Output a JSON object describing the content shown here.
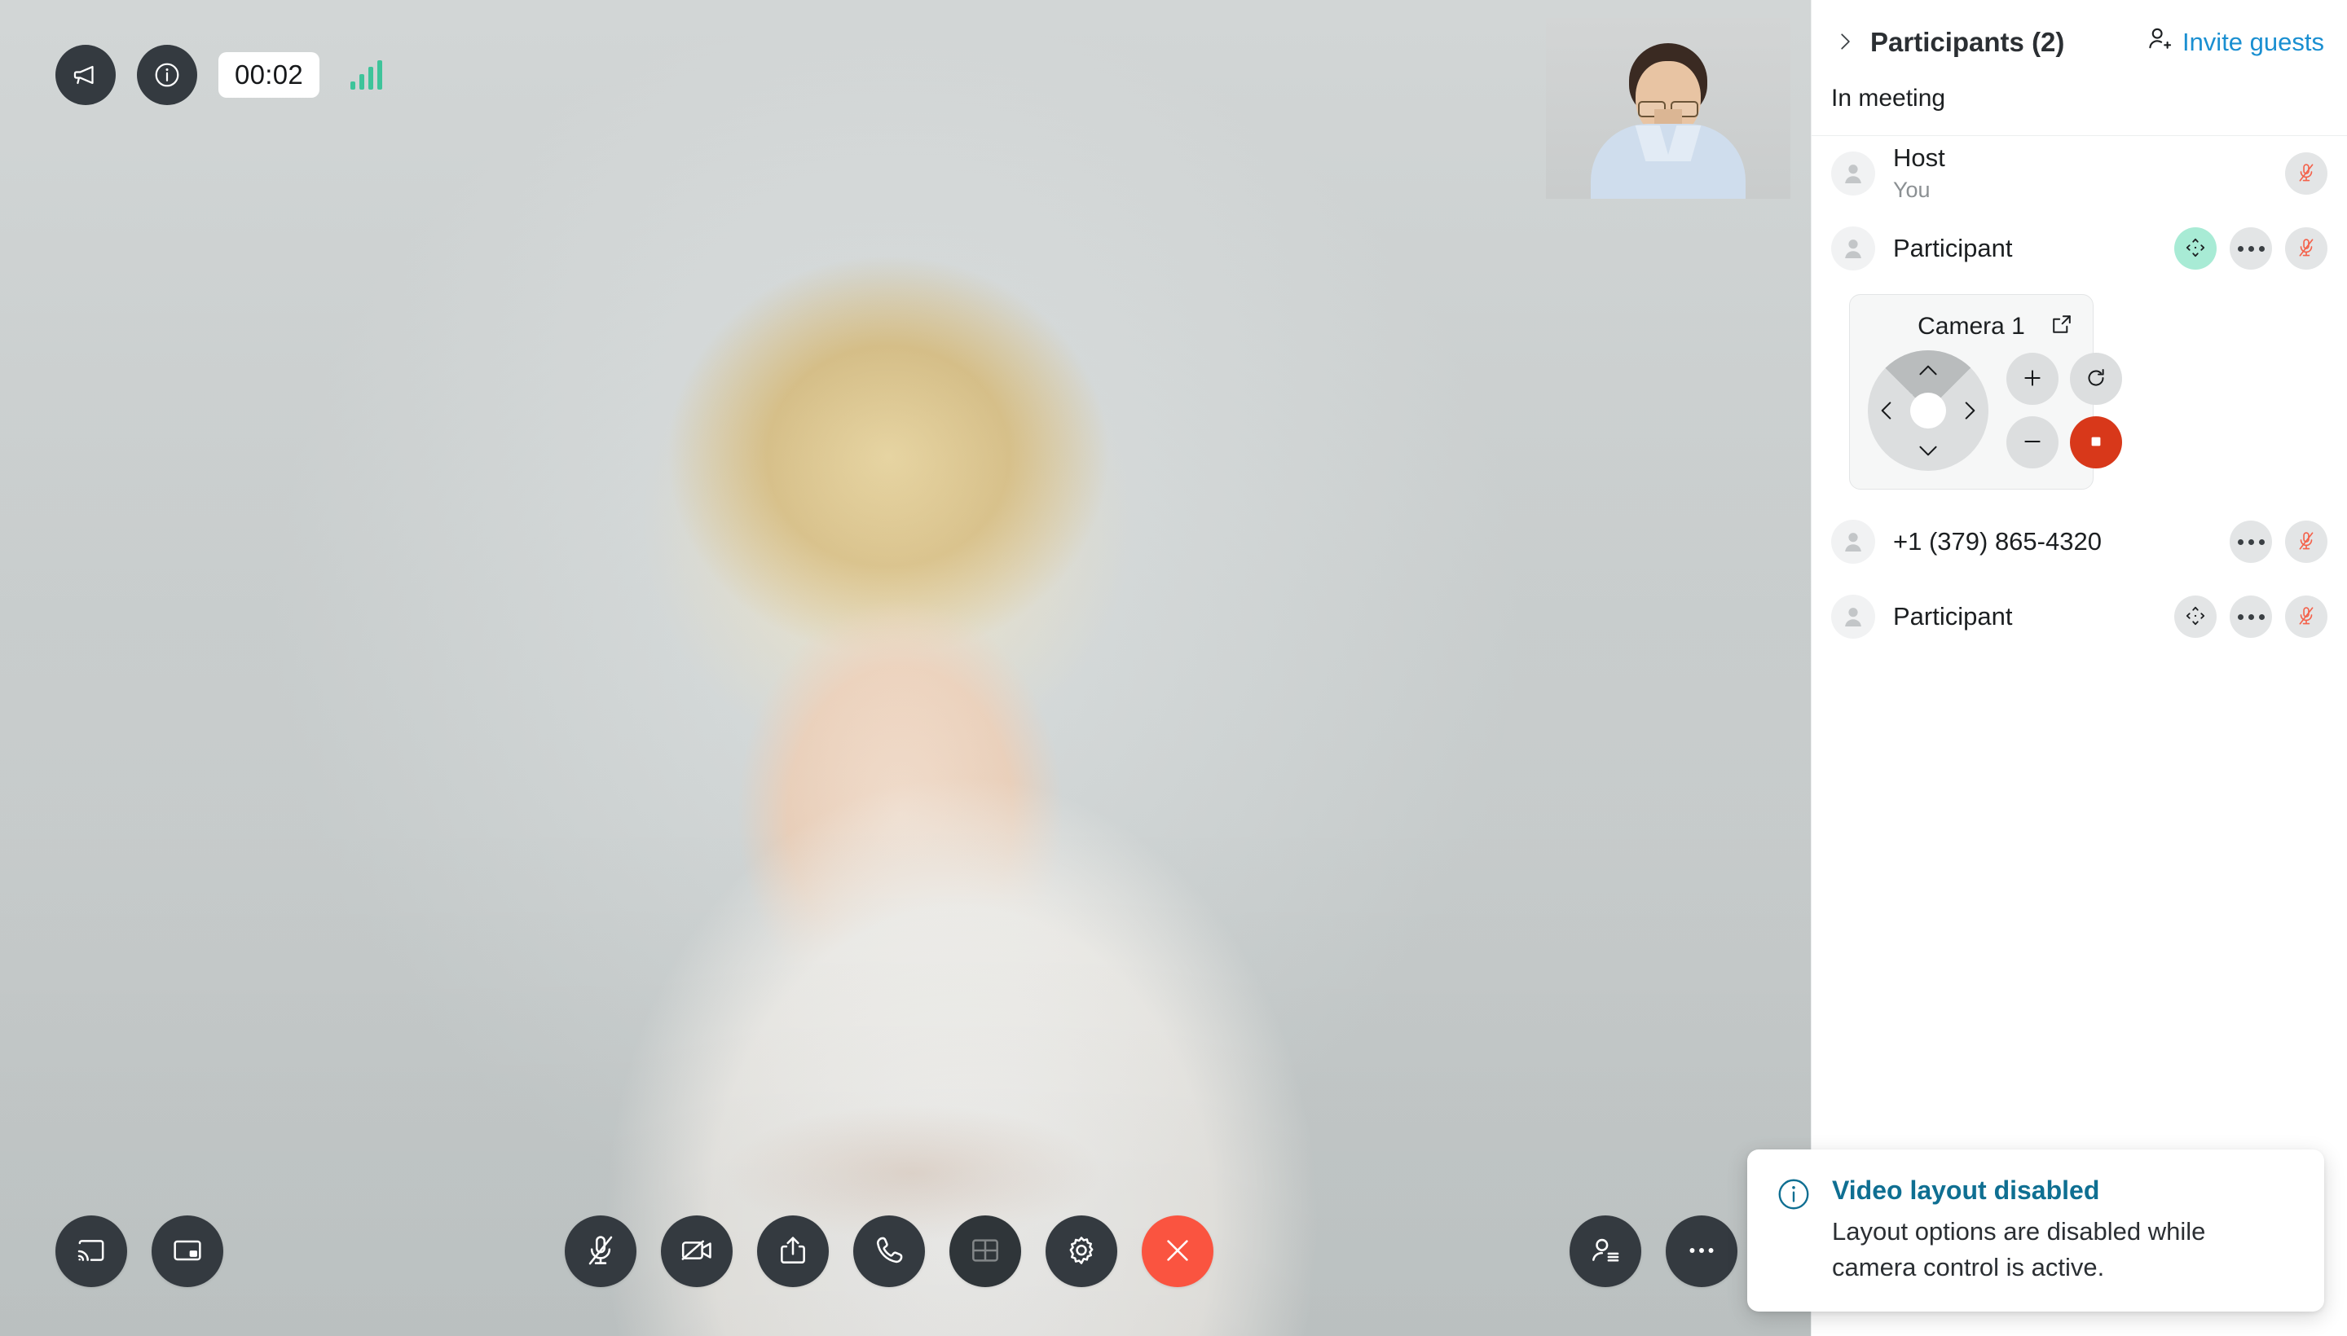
{
  "stage": {
    "timer": "00:02",
    "signal_bars": 4,
    "signal_color": "#3ec49a",
    "banner_icon": "megaphone-icon",
    "info_icon": "info-icon",
    "selfview_label": "self-view"
  },
  "toolbar": {
    "left": [
      {
        "name": "cast-button",
        "icon": "cast-icon"
      },
      {
        "name": "picture-in-picture-button",
        "icon": "picture-in-picture-icon"
      }
    ],
    "center": [
      {
        "name": "microphone-button",
        "icon": "microphone-muted-icon",
        "state": "muted"
      },
      {
        "name": "camera-button",
        "icon": "camera-off-icon",
        "state": "off"
      },
      {
        "name": "share-button",
        "icon": "share-icon",
        "state": "default"
      },
      {
        "name": "dialpad-button",
        "icon": "phone-icon",
        "state": "default"
      },
      {
        "name": "layout-button",
        "icon": "layout-grid-icon",
        "state": "disabled"
      },
      {
        "name": "settings-button",
        "icon": "gear-icon",
        "state": "default"
      },
      {
        "name": "end-call-button",
        "icon": "close-icon",
        "state": "danger",
        "color": "#fa5440"
      }
    ],
    "right": [
      {
        "name": "participants-button",
        "icon": "participants-icon"
      },
      {
        "name": "more-options-button",
        "icon": "more-icon"
      }
    ]
  },
  "sidebar": {
    "title": "Participants (2)",
    "collapse_icon": "chevron-right-icon",
    "invite_label": "Invite guests",
    "invite_icon": "add-person-icon",
    "invite_color": "#1a8fd1",
    "section_label": "In meeting",
    "participants": [
      {
        "name": "Host",
        "sub": "You",
        "avatar_icon": "person-icon",
        "has_camera_control": false,
        "has_more": false,
        "mic": "muted"
      },
      {
        "name": "Participant",
        "sub": "",
        "avatar_icon": "person-icon",
        "has_camera_control": true,
        "camera_control_active": true,
        "has_more": true,
        "mic": "muted"
      },
      {
        "name": "+1 (379) 865-4320",
        "sub": "",
        "avatar_icon": "person-icon",
        "has_camera_control": false,
        "has_more": true,
        "mic": "muted"
      },
      {
        "name": "Participant",
        "sub": "",
        "avatar_icon": "person-icon",
        "has_camera_control": true,
        "camera_control_active": false,
        "has_more": true,
        "mic": "muted"
      }
    ]
  },
  "camera_control": {
    "title": "Camera 1",
    "popout_icon": "open-external-icon",
    "dpad": {
      "up": "pan-up",
      "down": "pan-down",
      "left": "pan-left",
      "right": "pan-right",
      "active_direction": "up",
      "active_color": "#b9bcbd"
    },
    "zoom_in_label": "+",
    "zoom_out_label": "−",
    "reset_icon": "reset-icon",
    "stop_icon": "stop-icon",
    "stop_color": "#d8381a",
    "highlight_color": "#a8ebd5"
  },
  "toast": {
    "icon": "info-circle-icon",
    "title": "Video layout disabled",
    "title_color": "#0f6f92",
    "body": "Layout options are disabled while camera control is active."
  }
}
